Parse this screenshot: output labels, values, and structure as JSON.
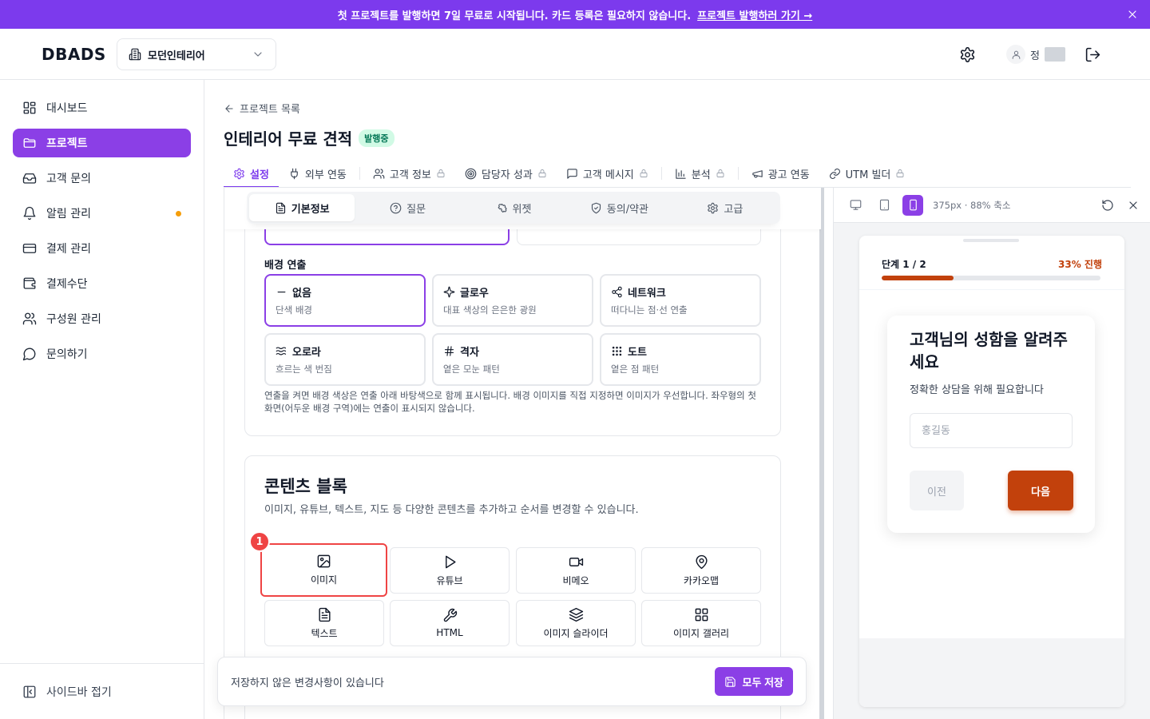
{
  "banner": {
    "text": "첫 프로젝트를 발행하면 7일 무료로 시작됩니다. 카드 등록은 필요하지 않습니다.",
    "link": "프로젝트 발행하러 가기 →"
  },
  "header": {
    "logo": "DBADS",
    "workspace": "모던인테리어",
    "user_name": "정"
  },
  "sidebar": {
    "items": [
      {
        "label": "대시보드",
        "icon": "dashboard-icon"
      },
      {
        "label": "프로젝트",
        "icon": "folder-icon",
        "active": true
      },
      {
        "label": "고객 문의",
        "icon": "inbox-icon"
      },
      {
        "label": "알림 관리",
        "icon": "bell-icon"
      },
      {
        "label": "결제 관리",
        "icon": "card-icon"
      },
      {
        "label": "결제수단",
        "icon": "wallet-icon"
      },
      {
        "label": "구성원 관리",
        "icon": "users-icon"
      },
      {
        "label": "문의하기",
        "icon": "chat-icon"
      }
    ],
    "collapse": "사이드바 접기"
  },
  "page": {
    "back": "프로젝트 목록",
    "title": "인테리어 무료 견적",
    "status": "발행중"
  },
  "tabs": [
    "설정",
    "외부 연동",
    "고객 정보",
    "담당자 성과",
    "고객 메시지",
    "분석",
    "광고 연동",
    "UTM 빌더"
  ],
  "subtabs": [
    "기본정보",
    "질문",
    "위젯",
    "동의/약관",
    "고급"
  ],
  "background": {
    "label": "배경 연출",
    "options": [
      {
        "title": "없음",
        "desc": "단색 배경"
      },
      {
        "title": "글로우",
        "desc": "대표 색상의 은은한 광원"
      },
      {
        "title": "네트워크",
        "desc": "떠다니는 점·선 연출"
      },
      {
        "title": "오로라",
        "desc": "흐르는 색 번짐"
      },
      {
        "title": "격자",
        "desc": "옅은 모눈 패턴"
      },
      {
        "title": "도트",
        "desc": "옅은 점 패턴"
      }
    ],
    "note": "연출을 켜면 배경 색상은 연출 아래 바탕색으로 함께 표시됩니다. 배경 이미지를 직접 지정하면 이미지가 우선합니다. 좌우형의 첫 화면(어두운 배경 구역)에는 연출이 표시되지 않습니다."
  },
  "content_blocks": {
    "title": "콘텐츠 블록",
    "desc": "이미지, 유튜브, 텍스트, 지도 등 다양한 콘텐츠를 추가하고 순서를 변경할 수 있습니다.",
    "marker": "1",
    "blocks": [
      "이미지",
      "유튜브",
      "비메오",
      "카카오맵",
      "텍스트",
      "HTML",
      "이미지 슬라이더",
      "이미지 갤러리"
    ]
  },
  "savebar": {
    "message": "저장하지 않은 변경사항이 있습니다",
    "button": "모두 저장"
  },
  "preview": {
    "info": "375px · 88% 축소",
    "step": "단계 1 / 2",
    "progress_text": "33% 진행",
    "progress": 0.33,
    "question": "고객님의 성함을 알려주세요",
    "question_desc": "정확한 상담을 위해 필요합니다",
    "placeholder": "홍길동",
    "prev": "이전",
    "next": "다음"
  },
  "colors": {
    "primary": "#8b3fe6",
    "banner": "#7c3aed",
    "preview_accent": "#c2410c",
    "highlight": "#ef4444"
  }
}
